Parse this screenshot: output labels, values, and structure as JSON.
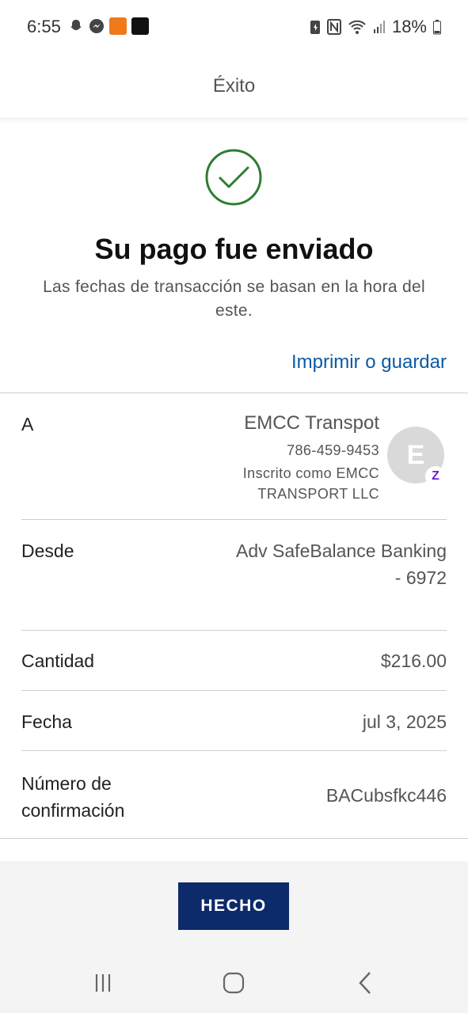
{
  "status_bar": {
    "time": "6:55",
    "battery": "18%"
  },
  "header": {
    "title": "Éxito"
  },
  "success": {
    "title": "Su pago fue enviado",
    "subtitle": "Las fechas de transacción se basan en la hora del este.",
    "print_link": "Imprimir o guardar",
    "accent_color": "#2e7d32"
  },
  "details": {
    "to": {
      "label": "A",
      "name": "EMCC Transpot",
      "phone": "786-459-9453",
      "enrolled_line1": "Inscrito como EMCC",
      "enrolled_line2": "TRANSPORT LLC",
      "avatar_letter": "E",
      "badge": "Z"
    },
    "from": {
      "label": "Desde",
      "value_line1": "Adv SafeBalance Banking",
      "value_line2": "- 6972"
    },
    "amount": {
      "label": "Cantidad",
      "value": "$216.00"
    },
    "date": {
      "label": "Fecha",
      "value": "jul 3, 2025"
    },
    "confirmation": {
      "label_line1": "Número de",
      "label_line2": "confirmación",
      "value": "BACubsfkc446"
    }
  },
  "footer": {
    "done_label": "HECHO",
    "button_color": "#0d2a6b"
  }
}
